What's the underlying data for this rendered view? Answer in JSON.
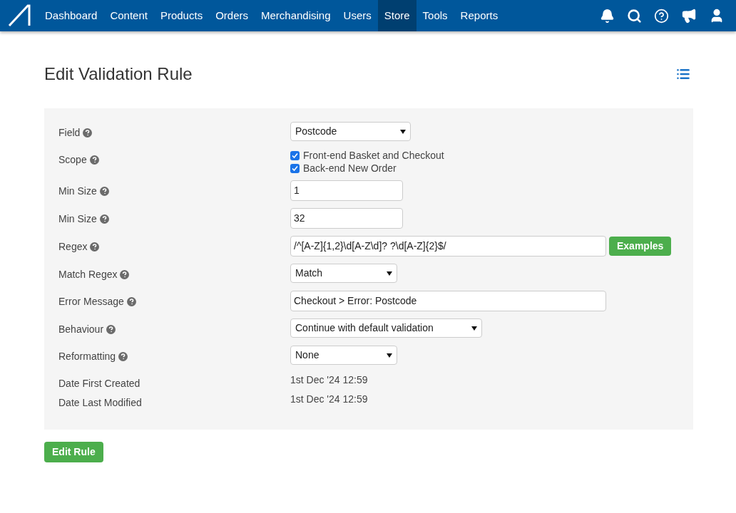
{
  "nav": {
    "items": [
      {
        "label": "Dashboard",
        "selected": false
      },
      {
        "label": "Content",
        "selected": false
      },
      {
        "label": "Products",
        "selected": false
      },
      {
        "label": "Orders",
        "selected": false
      },
      {
        "label": "Merchandising",
        "selected": false
      },
      {
        "label": "Users",
        "selected": false
      },
      {
        "label": "Store",
        "selected": true
      },
      {
        "label": "Tools",
        "selected": false
      },
      {
        "label": "Reports",
        "selected": false
      }
    ]
  },
  "page": {
    "title": "Edit Validation Rule"
  },
  "form": {
    "rows": [
      {
        "label": "Field",
        "help": true,
        "kind": "select",
        "value": "Postcode"
      },
      {
        "label": "Scope",
        "help": true,
        "kind": "checkboxes",
        "options": [
          {
            "label": "Front-end Basket and Checkout",
            "checked": true
          },
          {
            "label": "Back-end New Order",
            "checked": true
          }
        ]
      },
      {
        "label": "Min Size",
        "help": true,
        "kind": "input",
        "value": "1"
      },
      {
        "label": "Min Size",
        "help": true,
        "kind": "input",
        "value": "32"
      },
      {
        "label": "Regex",
        "help": true,
        "kind": "input_button",
        "value": "/^[A-Z]{1,2}\\d[A-Z\\d]? ?\\d[A-Z]{2}$/",
        "button": "Examples"
      },
      {
        "label": "Match Regex",
        "help": true,
        "kind": "select",
        "value": "Match"
      },
      {
        "label": "Error Message",
        "help": true,
        "kind": "input",
        "value": "Checkout > Error: Postcode"
      },
      {
        "label": "Behaviour",
        "help": true,
        "kind": "select",
        "value": "Continue with default validation"
      },
      {
        "label": "Reformatting",
        "help": true,
        "kind": "select",
        "value": "None"
      },
      {
        "label": "Date First Created",
        "help": false,
        "kind": "text",
        "value": "1st Dec '24 12:59"
      },
      {
        "label": "Date Last Modified",
        "help": false,
        "kind": "text",
        "value": "1st Dec '24 12:59"
      }
    ]
  },
  "submit": {
    "label": "Edit Rule"
  }
}
